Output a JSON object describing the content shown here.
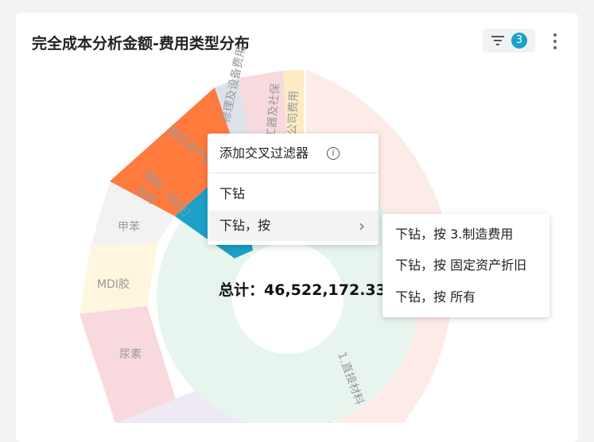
{
  "card": {
    "title": "完全成本分析金额-费用类型分布",
    "filter_count": "3"
  },
  "chart": {
    "labels": {
      "fixed_asset": "固定资产折旧",
      "equipment_fee": "修理及设备费用",
      "process": "工器及社保",
      "other": "公司费用",
      "aux": "辅料（除胶）",
      "stone": "石粉",
      "toluene": "甲苯",
      "mdi": "MDI胶",
      "urea": "尿素",
      "direct_material": "1.直接材料"
    },
    "total_label": "总计：46,522,172.33"
  },
  "context_menu": {
    "add_filter": "添加交叉过滤器",
    "drill": "下钻",
    "drill_by": "下钻，按"
  },
  "submenu": {
    "items": [
      "下钻，按 3.制造费用",
      "下钻，按 固定资产折旧",
      "下钻，按 所有"
    ]
  }
}
